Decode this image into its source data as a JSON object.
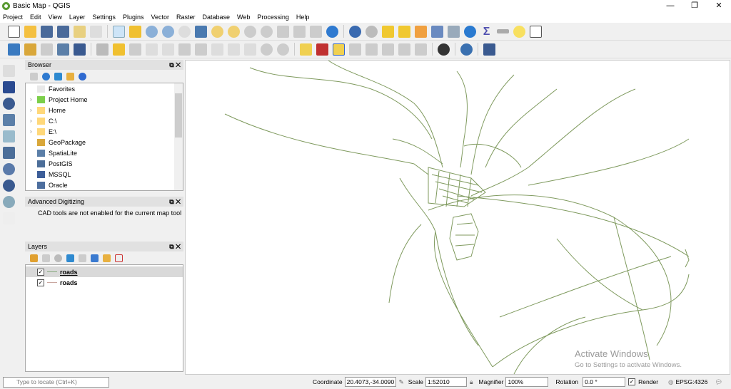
{
  "window": {
    "title": "Basic Map - QGIS",
    "controls": [
      "—",
      "❐",
      "✕"
    ]
  },
  "menu": [
    "Project",
    "Edit",
    "View",
    "Layer",
    "Settings",
    "Plugins",
    "Vector",
    "Raster",
    "Database",
    "Web",
    "Processing",
    "Help"
  ],
  "browser": {
    "title": "Browser",
    "items": [
      {
        "label": "Favorites",
        "expandable": false,
        "icon": "star-icon",
        "color": "#e8e8e8"
      },
      {
        "label": "Project Home",
        "expandable": true,
        "icon": "project-home-icon",
        "color": "#7ccf4a"
      },
      {
        "label": "Home",
        "expandable": true,
        "icon": "folder-icon",
        "color": "#ffd87a"
      },
      {
        "label": "C:\\",
        "expandable": true,
        "icon": "folder-icon",
        "color": "#ffd87a"
      },
      {
        "label": "E:\\",
        "expandable": true,
        "icon": "folder-icon",
        "color": "#ffd87a"
      },
      {
        "label": "GeoPackage",
        "expandable": false,
        "icon": "geopackage-icon",
        "color": "#d9a73a"
      },
      {
        "label": "SpatiaLite",
        "expandable": false,
        "icon": "feather-icon",
        "color": "#5b7fa8"
      },
      {
        "label": "PostGIS",
        "expandable": false,
        "icon": "elephant-icon",
        "color": "#4c6e99"
      },
      {
        "label": "MSSQL",
        "expandable": false,
        "icon": "mssql-icon",
        "color": "#3d5e99"
      },
      {
        "label": "Oracle",
        "expandable": false,
        "icon": "oracle-icon",
        "color": "#4d6e9e"
      }
    ]
  },
  "advanced_digitizing": {
    "title": "Advanced Digitizing",
    "message": "CAD tools are not enabled for the current map tool"
  },
  "layers": {
    "title": "Layers",
    "items": [
      {
        "label": "roads",
        "checked": true,
        "selected": true,
        "line_color": "#8aaa80"
      },
      {
        "label": "roads",
        "checked": true,
        "selected": false,
        "line_color": "#c9a7a0"
      }
    ]
  },
  "map": {
    "road_color": "#7f9a5e"
  },
  "watermark": {
    "line1": "Activate Windows",
    "line2": "Go to Settings to activate Windows."
  },
  "status": {
    "locate_placeholder": "Type to locate (Ctrl+K)",
    "coordinate_label": "Coordinate",
    "coordinate": "20.4073,-34.0090",
    "scale_label": "Scale",
    "scale": "1:52010",
    "magnifier_label": "Magnifier",
    "magnifier": "100%",
    "rotation_label": "Rotation",
    "rotation": "0.0 °",
    "render_label": "Render",
    "render_checked": true,
    "crs": "EPSG:4326"
  }
}
